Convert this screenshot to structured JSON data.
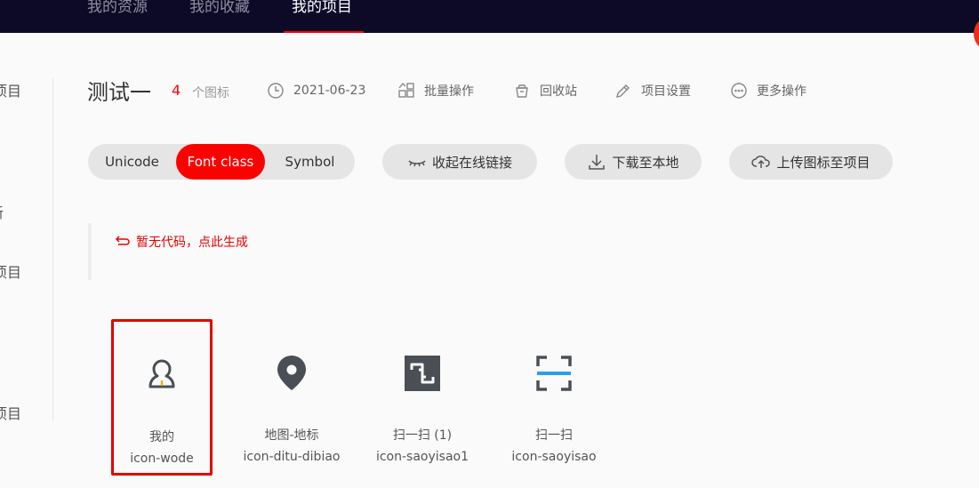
{
  "nav": {
    "items": [
      "我的资源",
      "我的收藏",
      "我的项目"
    ],
    "active_index": 2
  },
  "sidebar": {
    "cut_items": [
      "项目",
      "新",
      "项目",
      "项目"
    ]
  },
  "project": {
    "title": "测试一",
    "icon_count": "4",
    "icon_count_label": "个图标",
    "date": "2021-06-23",
    "actions": [
      "批量操作",
      "回收站",
      "项目设置",
      "更多操作"
    ]
  },
  "toolbar": {
    "tabs": [
      "Unicode",
      "Font class",
      "Symbol"
    ],
    "active_tab": "Font class",
    "collapse_link": "收起在线链接",
    "download": "下载至本地",
    "upload": "上传图标至项目"
  },
  "code": {
    "generate_text": "暂无代码，点此生成"
  },
  "icons": [
    {
      "name": "我的",
      "code": "icon-wode",
      "glyph": "user-icon",
      "selected": true
    },
    {
      "name": "地图-地标",
      "code": "icon-ditu-dibiao",
      "glyph": "map-pin-icon",
      "selected": false
    },
    {
      "name": "扫一扫 (1)",
      "code": "icon-saoyisao1",
      "glyph": "scan-square-icon",
      "selected": false
    },
    {
      "name": "扫一扫",
      "code": "icon-saoyisao",
      "glyph": "scan-frame-icon",
      "selected": false
    }
  ],
  "colors": {
    "accent": "#ff0000",
    "nav_bg": "#0d0a28",
    "scan_line": "#2a9df4",
    "icon_dark": "#4a4f56",
    "icon_highlight": "#f5a623"
  }
}
